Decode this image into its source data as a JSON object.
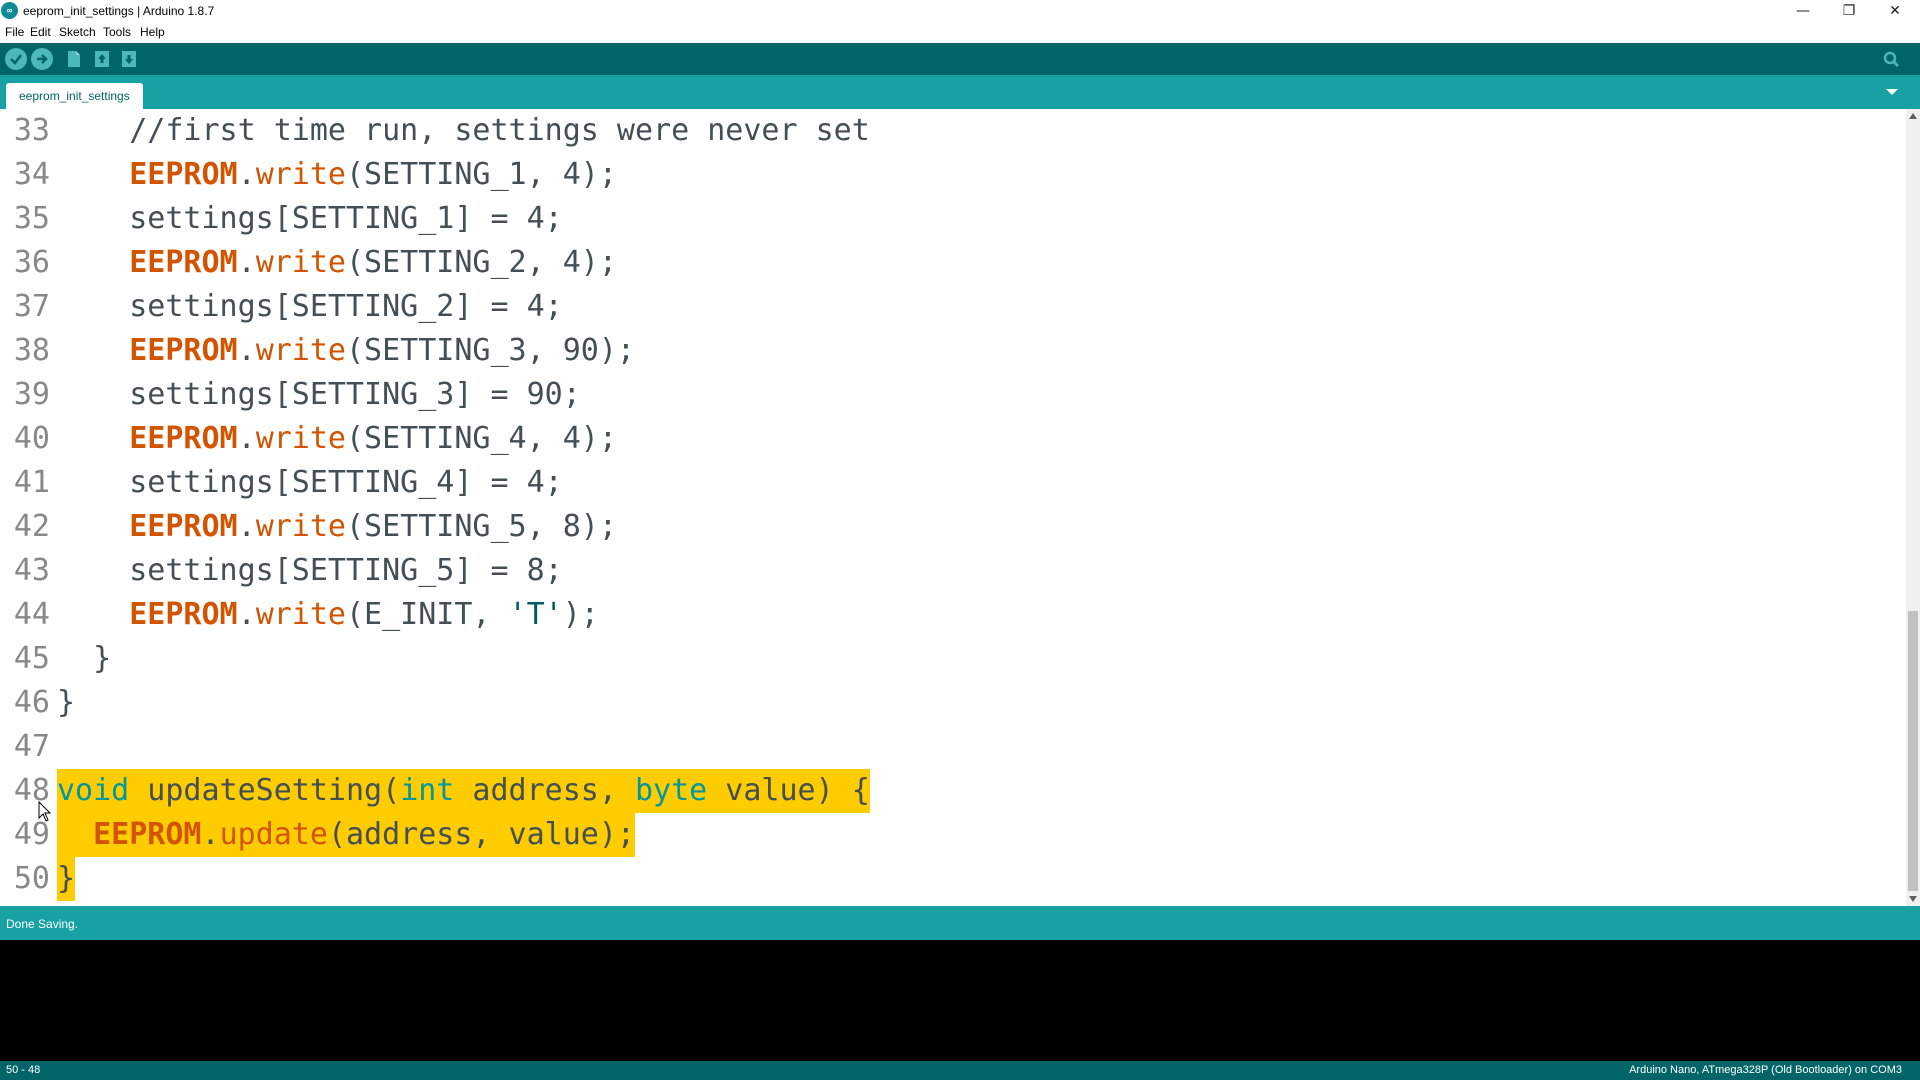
{
  "window": {
    "title": "eeprom_init_settings | Arduino 1.8.7",
    "app_icon_text": "∞",
    "controls": {
      "minimize": "—",
      "restore": "❐",
      "close": "✕"
    }
  },
  "menu": [
    "File",
    "Edit",
    "Sketch",
    "Tools",
    "Help"
  ],
  "toolbar": {
    "buttons": [
      "verify-icon",
      "upload-icon",
      "new-icon",
      "open-icon",
      "save-icon"
    ],
    "serial_monitor_icon": "serial-monitor-icon"
  },
  "tabs": [
    {
      "label": "eeprom_init_settings",
      "active": true
    }
  ],
  "editor": {
    "lines": [
      {
        "n": "33",
        "tokens": [
          {
            "t": "    //first time run, settings were never set",
            "c": "cm"
          }
        ]
      },
      {
        "n": "34",
        "tokens": [
          {
            "t": "    "
          },
          {
            "t": "EEPROM",
            "c": "kw"
          },
          {
            "t": "."
          },
          {
            "t": "write",
            "c": "fn"
          },
          {
            "t": "(SETTING_1, 4);"
          }
        ]
      },
      {
        "n": "35",
        "tokens": [
          {
            "t": "    settings[SETTING_1] = 4;"
          }
        ]
      },
      {
        "n": "36",
        "tokens": [
          {
            "t": "    "
          },
          {
            "t": "EEPROM",
            "c": "kw"
          },
          {
            "t": "."
          },
          {
            "t": "write",
            "c": "fn"
          },
          {
            "t": "(SETTING_2, 4);"
          }
        ]
      },
      {
        "n": "37",
        "tokens": [
          {
            "t": "    settings[SETTING_2] = 4;"
          }
        ]
      },
      {
        "n": "38",
        "tokens": [
          {
            "t": "    "
          },
          {
            "t": "EEPROM",
            "c": "kw"
          },
          {
            "t": "."
          },
          {
            "t": "write",
            "c": "fn"
          },
          {
            "t": "(SETTING_3, 90);"
          }
        ]
      },
      {
        "n": "39",
        "tokens": [
          {
            "t": "    settings[SETTING_3] = 90;"
          }
        ]
      },
      {
        "n": "40",
        "tokens": [
          {
            "t": "    "
          },
          {
            "t": "EEPROM",
            "c": "kw"
          },
          {
            "t": "."
          },
          {
            "t": "write",
            "c": "fn"
          },
          {
            "t": "(SETTING_4, 4);"
          }
        ]
      },
      {
        "n": "41",
        "tokens": [
          {
            "t": "    settings[SETTING_4] = 4;"
          }
        ]
      },
      {
        "n": "42",
        "tokens": [
          {
            "t": "    "
          },
          {
            "t": "EEPROM",
            "c": "kw"
          },
          {
            "t": "."
          },
          {
            "t": "write",
            "c": "fn"
          },
          {
            "t": "(SETTING_5, 8);"
          }
        ]
      },
      {
        "n": "43",
        "tokens": [
          {
            "t": "    settings[SETTING_5] = 8;"
          }
        ]
      },
      {
        "n": "44",
        "tokens": [
          {
            "t": "    "
          },
          {
            "t": "EEPROM",
            "c": "kw"
          },
          {
            "t": "."
          },
          {
            "t": "write",
            "c": "fn"
          },
          {
            "t": "(E_INIT, "
          },
          {
            "t": "'T'",
            "c": "str"
          },
          {
            "t": ");"
          }
        ]
      },
      {
        "n": "45",
        "tokens": [
          {
            "t": "  }"
          }
        ]
      },
      {
        "n": "46",
        "tokens": [
          {
            "t": "}"
          }
        ]
      },
      {
        "n": "47",
        "tokens": [
          {
            "t": ""
          }
        ]
      },
      {
        "n": "48",
        "hl": true,
        "tokens": [
          {
            "t": "void",
            "c": "ty"
          },
          {
            "t": " updateSetting("
          },
          {
            "t": "int",
            "c": "ty"
          },
          {
            "t": " address, "
          },
          {
            "t": "byte",
            "c": "ty"
          },
          {
            "t": " value) {"
          }
        ]
      },
      {
        "n": "49",
        "hl": true,
        "tokens": [
          {
            "t": "  "
          },
          {
            "t": "EEPROM",
            "c": "kw"
          },
          {
            "t": "."
          },
          {
            "t": "update",
            "c": "fn"
          },
          {
            "t": "(address, value);"
          }
        ]
      },
      {
        "n": "50",
        "hl": true,
        "tokens": [
          {
            "t": "}"
          }
        ]
      }
    ]
  },
  "status": {
    "message": "Done Saving."
  },
  "footer": {
    "position": "50 - 48",
    "board": "Arduino Nano, ATmega328P (Old Bootloader) on COM3"
  },
  "colors": {
    "toolbar": "#006468",
    "tabbar": "#17a1a5",
    "highlight": "#ffcc00",
    "keyword": "#d35400",
    "type": "#00979d"
  }
}
